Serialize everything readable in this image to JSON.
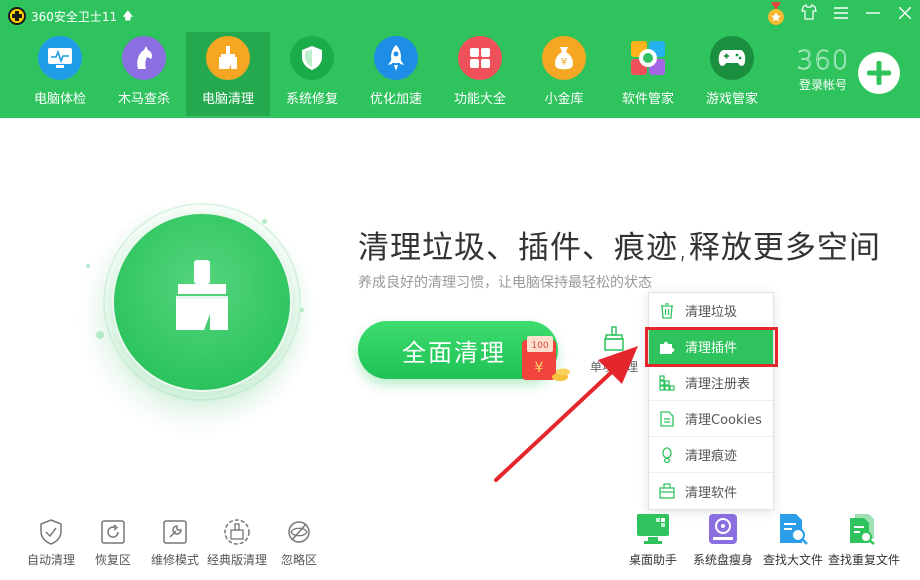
{
  "app": {
    "title": "360安全卫士11"
  },
  "colors": {
    "brand_green": "#2fc35e",
    "active_nav": "#24a94f",
    "highlight_red": "#e5272d",
    "text_dark": "#333333",
    "text_muted": "#999999"
  },
  "nav": {
    "items": [
      {
        "label": "电脑体检",
        "icon": "monitor-icon"
      },
      {
        "label": "木马查杀",
        "icon": "horse-icon"
      },
      {
        "label": "电脑清理",
        "icon": "broom-icon",
        "active": true
      },
      {
        "label": "系统修复",
        "icon": "shield-icon"
      },
      {
        "label": "优化加速",
        "icon": "rocket-icon"
      },
      {
        "label": "功能大全",
        "icon": "grid-icon"
      },
      {
        "label": "小金库",
        "icon": "money-bag-icon"
      },
      {
        "label": "软件管家",
        "icon": "software-store-icon"
      },
      {
        "label": "游戏管家",
        "icon": "gamepad-icon"
      }
    ]
  },
  "account": {
    "brand": "360",
    "login_label": "登录帐号"
  },
  "main": {
    "headline": "清理垃圾、插件、痕迹,释放更多空间",
    "subline": "养成良好的清理习惯，让电脑保持最轻松的状态",
    "clean_button": "全面清理",
    "envelope_amount": "100",
    "single_clean": "单项清理"
  },
  "dropdown": {
    "items": [
      {
        "label": "清理垃圾",
        "icon": "trash-icon"
      },
      {
        "label": "清理插件",
        "icon": "puzzle-icon",
        "active": true
      },
      {
        "label": "清理注册表",
        "icon": "registry-icon"
      },
      {
        "label": "清理Cookies",
        "icon": "cookie-doc-icon"
      },
      {
        "label": "清理痕迹",
        "icon": "footprint-icon"
      },
      {
        "label": "清理软件",
        "icon": "software-box-icon"
      }
    ]
  },
  "bottom_left": [
    {
      "label": "自动清理",
      "icon": "shield-check-icon"
    },
    {
      "label": "恢复区",
      "icon": "restore-icon"
    },
    {
      "label": "维修模式",
      "icon": "wrench-icon"
    },
    {
      "label": "经典版清理",
      "icon": "classic-clean-icon"
    },
    {
      "label": "忽略区",
      "icon": "ignore-eye-icon"
    }
  ],
  "bottom_right": [
    {
      "label": "桌面助手",
      "icon": "desktop-helper-icon"
    },
    {
      "label": "系统盘瘦身",
      "icon": "disk-slim-icon"
    },
    {
      "label": "查找大文件",
      "icon": "find-large-file-icon"
    },
    {
      "label": "查找重复文件",
      "icon": "find-duplicate-icon"
    }
  ]
}
